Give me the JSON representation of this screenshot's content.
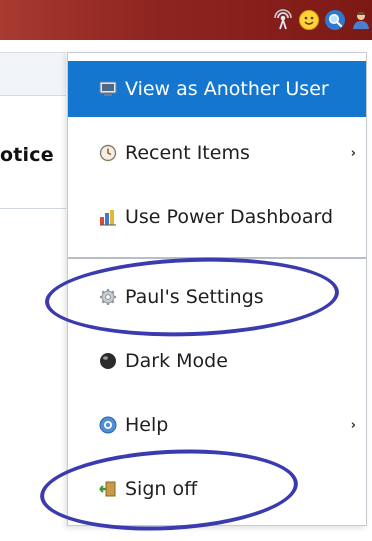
{
  "header": {
    "icons": [
      "broadcast-icon",
      "smiley-icon",
      "search-icon",
      "user-icon"
    ],
    "colors": {
      "bar": "#8f2520",
      "highlight": "#1476cf",
      "annotation": "#3b3bb0"
    }
  },
  "background": {
    "partial_word": "otice"
  },
  "menu": {
    "items": [
      {
        "label": "View as Another User",
        "icon": "monitor-icon",
        "highlighted": true
      },
      {
        "label": "Recent Items",
        "icon": "clock-icon",
        "submenu": "›"
      },
      {
        "label": "Use Power Dashboard",
        "icon": "dashboard-icon"
      },
      {
        "label": "Paul's Settings",
        "icon": "gear-icon"
      },
      {
        "label": "Dark Mode",
        "icon": "moon-ball-icon"
      },
      {
        "label": "Help",
        "icon": "help-icon",
        "submenu": "›"
      },
      {
        "label": "Sign off",
        "icon": "door-exit-icon"
      }
    ]
  }
}
